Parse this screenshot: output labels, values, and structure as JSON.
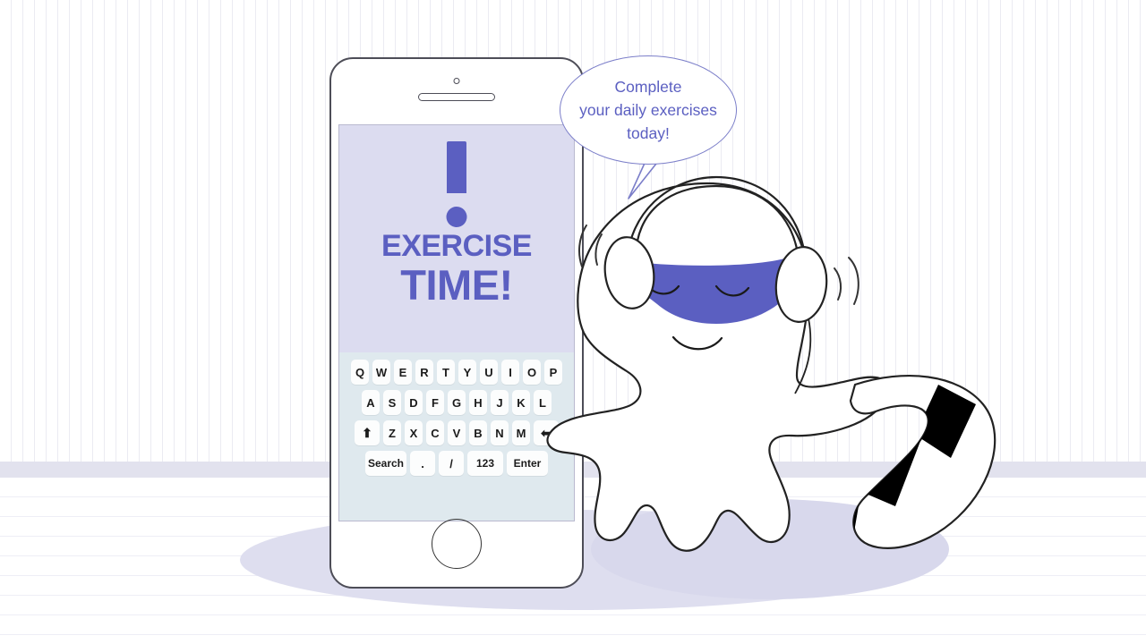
{
  "scene": {
    "title": "Exercise Time mobile reminder illustration",
    "background": {
      "wall_pattern": "vertical-stripes",
      "floor_pattern": "horizontal-lines",
      "wall_stripe_color": "#ebebf2",
      "floor_line_color": "#eeeef6",
      "skirting_color": "#e2e2ee",
      "shadow_color": "#d8d8ec"
    },
    "accent_color": "#5b5fc1",
    "screen_bg_color": "#dcdcf0",
    "keyboard_bg_color": "#dfe9ee",
    "key_color": "#fcfdfd",
    "outline_color": "#222222"
  },
  "speech_bubble": {
    "line1": "Complete",
    "line2": "your daily exercises",
    "line3": "today!",
    "border_color": "#7b7ec9",
    "text_color": "#5b5fc1"
  },
  "phone": {
    "frame_color": "#4d4d57",
    "camera_icon": "camera-dot-icon",
    "speaker_icon": "speaker-slot-icon",
    "home_button_icon": "home-button-icon",
    "screen": {
      "alert_icon": "exclamation-mark-icon",
      "headline_line1": "EXERCISE",
      "headline_line2": "TIME!"
    },
    "keyboard": {
      "rows": [
        {
          "name": "row-1",
          "keys": [
            {
              "label": "Q",
              "icon": null,
              "type": "letter"
            },
            {
              "label": "W",
              "icon": null,
              "type": "letter"
            },
            {
              "label": "E",
              "icon": null,
              "type": "letter"
            },
            {
              "label": "R",
              "icon": null,
              "type": "letter"
            },
            {
              "label": "T",
              "icon": null,
              "type": "letter"
            },
            {
              "label": "Y",
              "icon": null,
              "type": "letter"
            },
            {
              "label": "U",
              "icon": null,
              "type": "letter"
            },
            {
              "label": "I",
              "icon": null,
              "type": "letter"
            },
            {
              "label": "O",
              "icon": null,
              "type": "letter"
            },
            {
              "label": "P",
              "icon": null,
              "type": "letter"
            }
          ]
        },
        {
          "name": "row-2",
          "keys": [
            {
              "label": "A",
              "icon": null,
              "type": "letter"
            },
            {
              "label": "S",
              "icon": null,
              "type": "letter"
            },
            {
              "label": "D",
              "icon": null,
              "type": "letter"
            },
            {
              "label": "F",
              "icon": null,
              "type": "letter"
            },
            {
              "label": "G",
              "icon": null,
              "type": "letter"
            },
            {
              "label": "H",
              "icon": null,
              "type": "letter"
            },
            {
              "label": "J",
              "icon": null,
              "type": "letter"
            },
            {
              "label": "K",
              "icon": null,
              "type": "letter"
            },
            {
              "label": "L",
              "icon": null,
              "type": "letter"
            }
          ]
        },
        {
          "name": "row-3",
          "keys": [
            {
              "label": "⬆",
              "icon": "shift-arrow-icon",
              "type": "modifier"
            },
            {
              "label": "Z",
              "icon": null,
              "type": "letter"
            },
            {
              "label": "X",
              "icon": null,
              "type": "letter"
            },
            {
              "label": "C",
              "icon": null,
              "type": "letter"
            },
            {
              "label": "V",
              "icon": null,
              "type": "letter"
            },
            {
              "label": "B",
              "icon": null,
              "type": "letter"
            },
            {
              "label": "N",
              "icon": null,
              "type": "letter"
            },
            {
              "label": "M",
              "icon": null,
              "type": "letter"
            },
            {
              "label": "⬅",
              "icon": "backspace-arrow-icon",
              "type": "modifier"
            }
          ]
        },
        {
          "name": "row-4",
          "keys": [
            {
              "label": "Search",
              "icon": null,
              "type": "action"
            },
            {
              "label": ".",
              "icon": null,
              "type": "symbol"
            },
            {
              "label": "/",
              "icon": null,
              "type": "symbol"
            },
            {
              "label": "123",
              "icon": null,
              "type": "numeric-toggle"
            },
            {
              "label": "Enter",
              "icon": null,
              "type": "action"
            }
          ]
        }
      ]
    }
  },
  "mascot": {
    "name": "blob-ghost-mascot",
    "sleep_mask_color": "#5b5fc1",
    "headphones_icon": "headphones-icon",
    "sock_stripe_color": "#000000",
    "motion_lines": "motion-arc-icon",
    "expression": "closed-eyes-smile"
  }
}
